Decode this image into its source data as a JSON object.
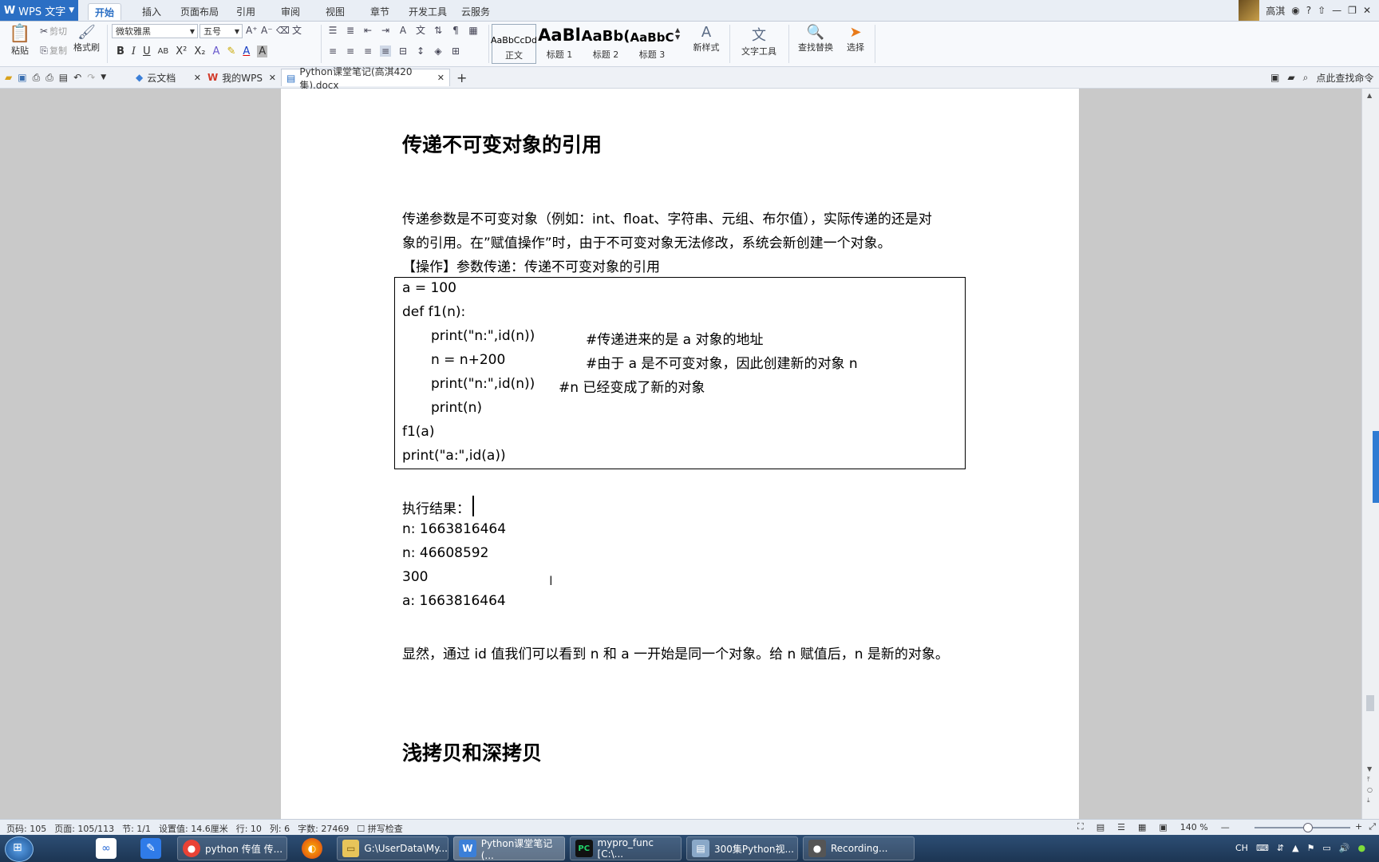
{
  "app": {
    "name": "WPS 文字"
  },
  "menu": [
    "开始",
    "插入",
    "页面布局",
    "引用",
    "审阅",
    "视图",
    "章节",
    "开发工具",
    "云服务"
  ],
  "user": {
    "name": "高淇"
  },
  "ribbon": {
    "paste": "粘贴",
    "cut": "剪切",
    "copy": "复制",
    "format_painter": "格式刷",
    "font_name": "微软雅黑",
    "font_size": "五号",
    "styles": [
      {
        "preview": "AaBbCcDd",
        "label": "正文"
      },
      {
        "preview": "AaBl",
        "label": "标题 1"
      },
      {
        "preview": "AaBb(",
        "label": "标题 2"
      },
      {
        "preview": "AaBbC",
        "label": "标题 3"
      }
    ],
    "new_style": "新样式",
    "text_tools": "文字工具",
    "find_replace": "查找替换",
    "select": "选择"
  },
  "tabs": [
    {
      "label": "云文档"
    },
    {
      "label": "我的WPS"
    },
    {
      "label": "Python课堂笔记(高淇420集).docx"
    }
  ],
  "find_command": "点此查找命令",
  "document": {
    "heading1": "传递不可变对象的引用",
    "para1_line1": "传递参数是不可变对象（例如：int、float、字符串、元组、布尔值），实际传递的还是对",
    "para1_line2": "象的引用。在”赋值操作”时，由于不可变对象无法修改，系统会新创建一个对象。",
    "op_label": "【操作】参数传递：传递不可变对象的引用",
    "code": [
      {
        "text": "a = 100",
        "comment": ""
      },
      {
        "text": "def f1(n):",
        "comment": ""
      },
      {
        "text": "print(\"n:\",id(n))",
        "comment": "#传递进来的是 a 对象的地址"
      },
      {
        "text": "n = n+200",
        "comment": "#由于 a 是不可变对象，因此创建新的对象 n"
      },
      {
        "text": "print(\"n:\",id(n))",
        "comment": "#n 已经变成了新的对象"
      },
      {
        "text": "print(n)",
        "comment": ""
      },
      {
        "text": "f1(a)",
        "comment": ""
      },
      {
        "text": "print(\"a:\",id(a))",
        "comment": ""
      }
    ],
    "result_label": "执行结果：",
    "results": [
      "n: 1663816464",
      "n: 46608592",
      "300",
      "a: 1663816464"
    ],
    "conclusion": "显然，通过 id 值我们可以看到 n 和 a 一开始是同一个对象。给 n 赋值后，n 是新的对象。",
    "heading2": "浅拷贝和深拷贝"
  },
  "status": {
    "page_no": "页码: 105",
    "pages": "页面: 105/113",
    "section": "节: 1/1",
    "setting": "设置值: 14.6厘米",
    "row": "行: 10",
    "col": "列: 6",
    "words": "字数: 27469",
    "spell": "拼写检查",
    "zoom": "140 %"
  },
  "zoom_level": 0.55,
  "taskbar": [
    {
      "label": "python 传值 传...",
      "icon": "chrome-icon",
      "color": "#e94235"
    },
    {
      "label": "G:\\UserData\\My...",
      "icon": "folder-icon",
      "color": "#e8c45a"
    },
    {
      "label": "Python课堂笔记(...",
      "icon": "wps-icon",
      "color": "#3b7fd8"
    },
    {
      "label": "mypro_func [C:\\...",
      "icon": "pycharm-icon",
      "color": "#21b35a"
    },
    {
      "label": "300集Python视...",
      "icon": "document-icon",
      "color": "#8aa8c8"
    },
    {
      "label": "Recording...",
      "icon": "recorder-icon",
      "color": "#555555"
    }
  ],
  "tray": {
    "lang": "CH"
  }
}
